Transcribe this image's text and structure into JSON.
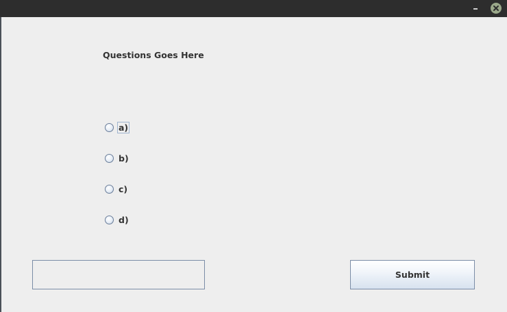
{
  "window": {
    "minimize_glyph": "-",
    "close_glyph": "×"
  },
  "question": {
    "text": "Questions Goes Here"
  },
  "options": [
    {
      "label": "a)",
      "selected": false,
      "focused": true
    },
    {
      "label": "b)",
      "selected": false,
      "focused": false
    },
    {
      "label": "c)",
      "selected": false,
      "focused": false
    },
    {
      "label": "d)",
      "selected": false,
      "focused": false
    }
  ],
  "answer_field": {
    "value": ""
  },
  "submit": {
    "label": "Submit"
  },
  "colors": {
    "titlebar": "#2d2d2d",
    "background": "#eeeeee",
    "close_button": "#9aa88a",
    "border": "#7a8ca6",
    "text": "#333333"
  }
}
